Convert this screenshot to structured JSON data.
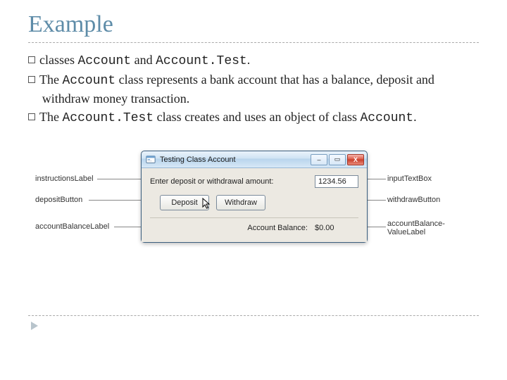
{
  "title": "Example",
  "bullets": {
    "b1": {
      "pre": "classes ",
      "c1": "Account",
      "mid": " and ",
      "c2": "Account.Test",
      "post": "."
    },
    "b2": {
      "pre": "The ",
      "c1": "Account",
      "post": " class represents a bank account that has a balance, deposit and withdraw money transaction."
    },
    "b3": {
      "pre": "The ",
      "c1": "Account.Test",
      "mid": " class creates and uses an object of class ",
      "c2": "Account",
      "post": "."
    }
  },
  "dialog": {
    "title": "Testing Class Account",
    "instructions": "Enter deposit or withdrawal amount:",
    "inputValue": "1234.56",
    "depositLabel": "Deposit",
    "withdrawLabel": "Withdraw",
    "balanceLabel": "Account Balance:",
    "balanceValue": "$0.00",
    "minGlyph": "–",
    "maxGlyph": "▭",
    "closeGlyph": "X"
  },
  "annotations": {
    "instructionsLabel": "instructionsLabel",
    "depositButton": "depositButton",
    "accountBalanceLabel": "accountBalanceLabel",
    "inputTextBox": "inputTextBox",
    "withdrawButton": "withdrawButton",
    "accountBalanceValueLabel": "accountBalance-\nValueLabel"
  }
}
